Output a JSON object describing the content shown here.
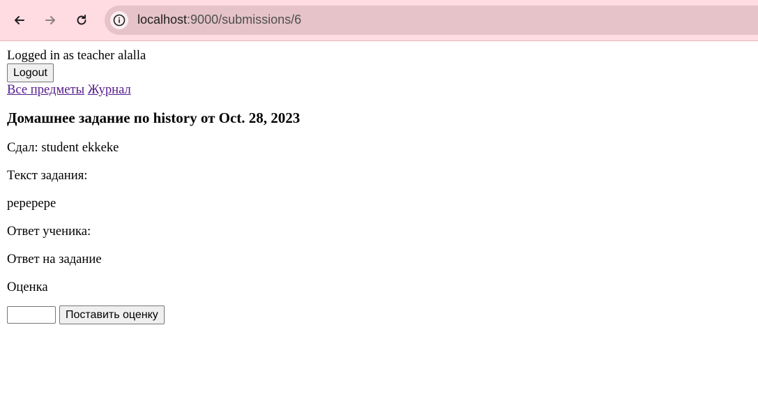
{
  "browser": {
    "url_host": "localhost",
    "url_path": ":9000/submissions/6"
  },
  "header": {
    "logged_in_text": "Logged in as teacher alalla",
    "logout_label": "Logout",
    "nav": [
      "Все предметы",
      "Журнал"
    ]
  },
  "main": {
    "title": "Домашнее задание по history от Oct. 28, 2023",
    "submitted_by": "Сдал: student ekkeke",
    "task_text_label": "Текст задания:",
    "task_text": "реререре",
    "student_answer_label": "Ответ ученика:",
    "student_answer": "Ответ на задание",
    "grade_label": "Оценка",
    "grade_value": "",
    "submit_grade_label": "Поставить оценку"
  }
}
